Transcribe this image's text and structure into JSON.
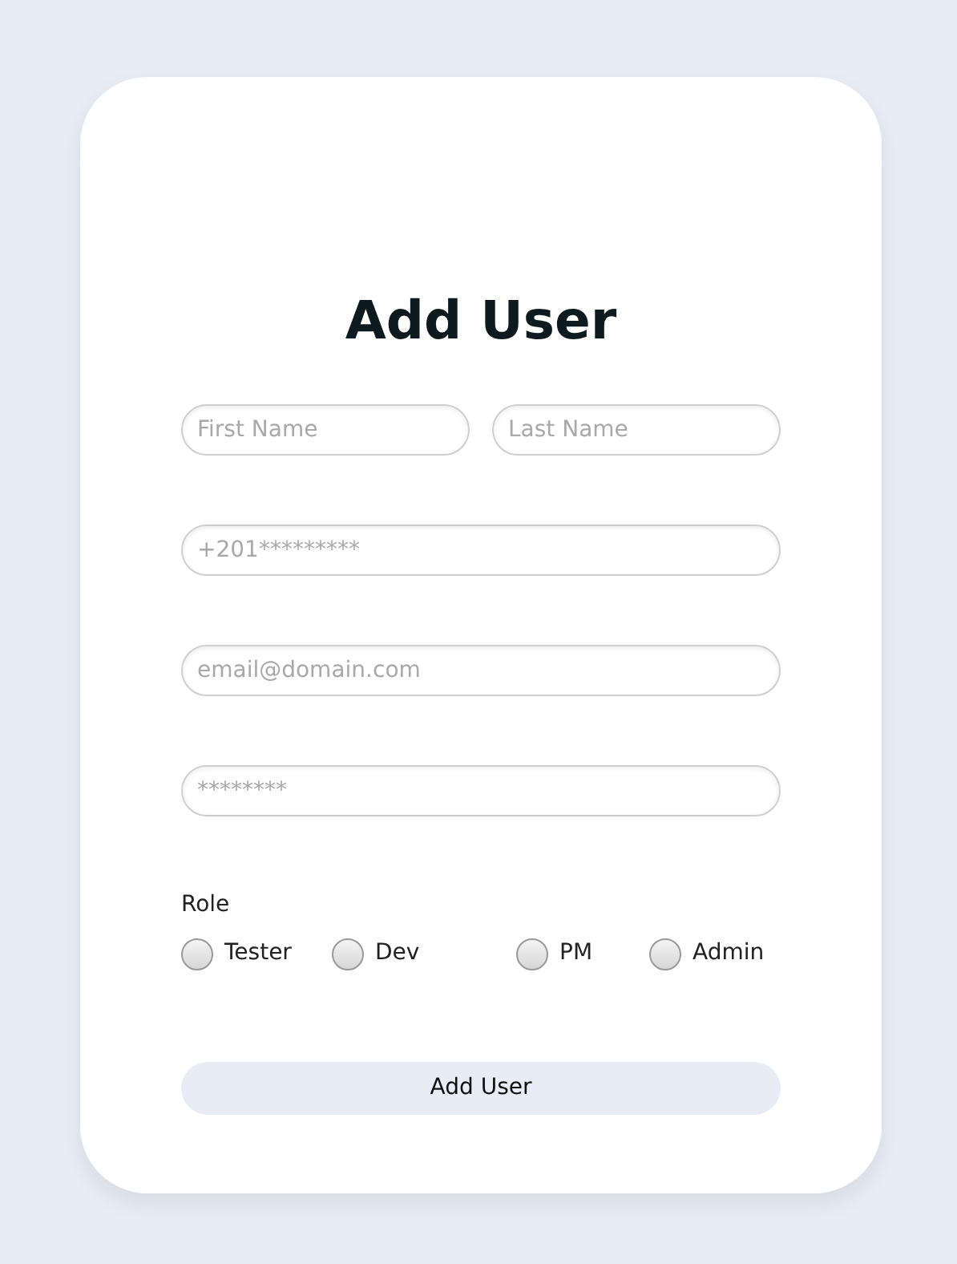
{
  "title": "Add User",
  "fields": [
    {
      "placeholder": "First Name"
    },
    {
      "placeholder": "Last Name"
    },
    {
      "placeholder": "+201*********"
    },
    {
      "placeholder": "email@domain.com"
    },
    {
      "placeholder": "********"
    }
  ],
  "role": {
    "label": "Role",
    "options": [
      {
        "label": "Tester",
        "selected": false
      },
      {
        "label": "Dev",
        "selected": false
      },
      {
        "label": "PM",
        "selected": false
      },
      {
        "label": "Admin",
        "selected": false
      }
    ]
  },
  "submit": "Add User"
}
